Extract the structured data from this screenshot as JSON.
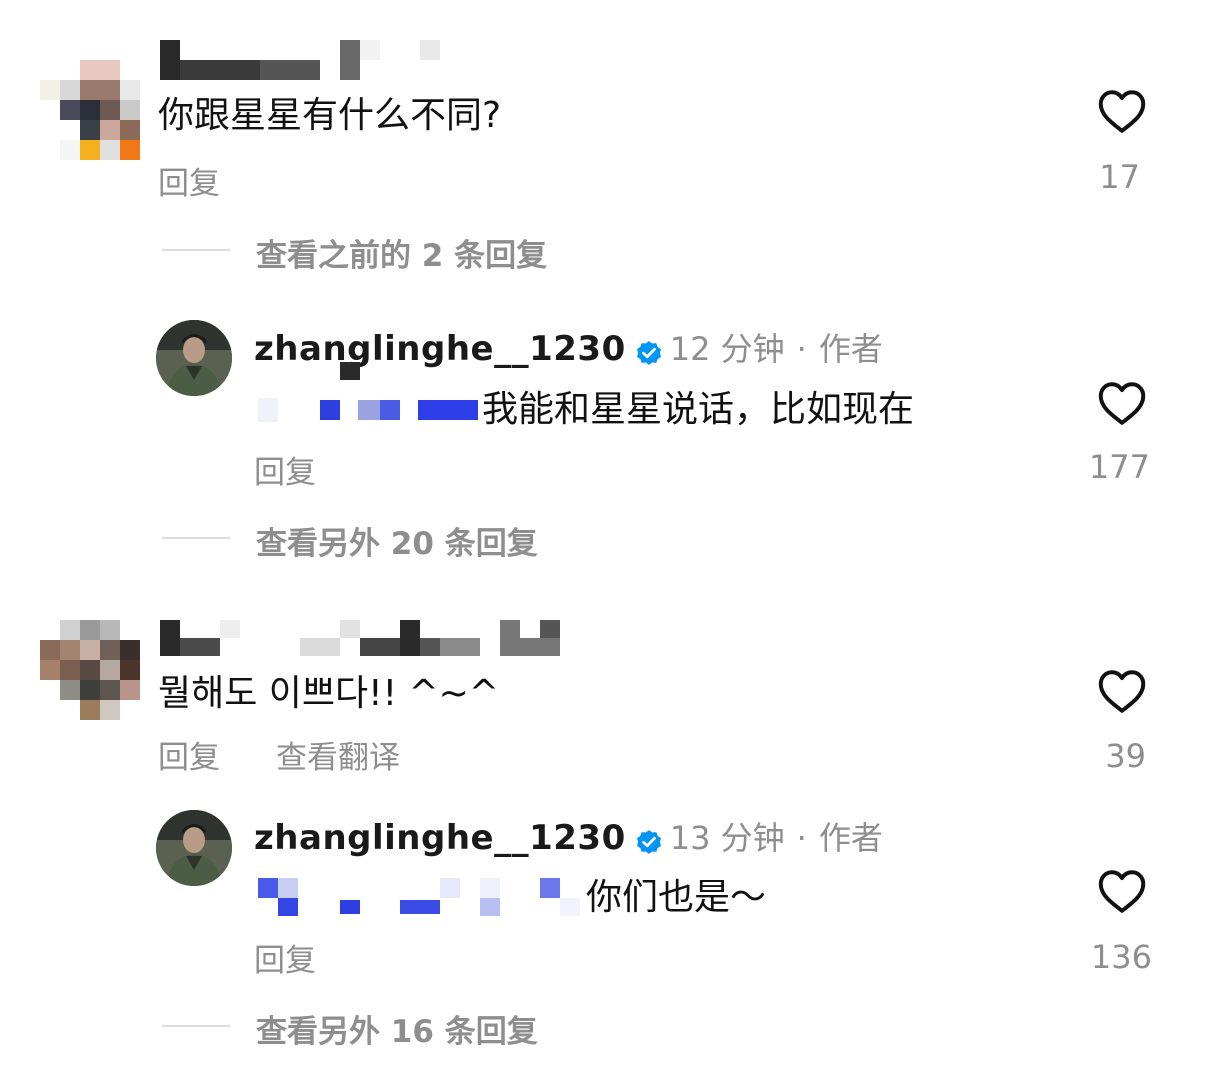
{
  "comments": [
    {
      "text": "你跟星星有什么不同?",
      "actions": {
        "reply": "回复"
      },
      "likes": "17",
      "view_previous": "查看之前的 2 条回复",
      "reply": {
        "username": "zhanglinghe__1230",
        "time": "12 分钟",
        "separator": "·",
        "role": "作者",
        "text": "我能和星星说话，比如现在",
        "actions": {
          "reply": "回复"
        },
        "likes": "177"
      },
      "view_more": "查看另外 20 条回复"
    },
    {
      "text": "뭘해도 이쁘다!! ^~^",
      "actions": {
        "reply": "回复",
        "translate": "查看翻译"
      },
      "likes": "39",
      "reply": {
        "username": "zhanglinghe__1230",
        "time": "13 分钟",
        "separator": "·",
        "role": "作者",
        "text": "你们也是～",
        "actions": {
          "reply": "回复"
        },
        "likes": "136"
      },
      "view_more": "查看另外 16 条回复"
    }
  ],
  "icons": {
    "like": "heart-outline-icon",
    "verified": "verified-badge-icon"
  },
  "colors": {
    "verified_blue": "#0095f6",
    "secondary_text": "#8e8e8e",
    "mention_blur": "#3b4de0"
  }
}
